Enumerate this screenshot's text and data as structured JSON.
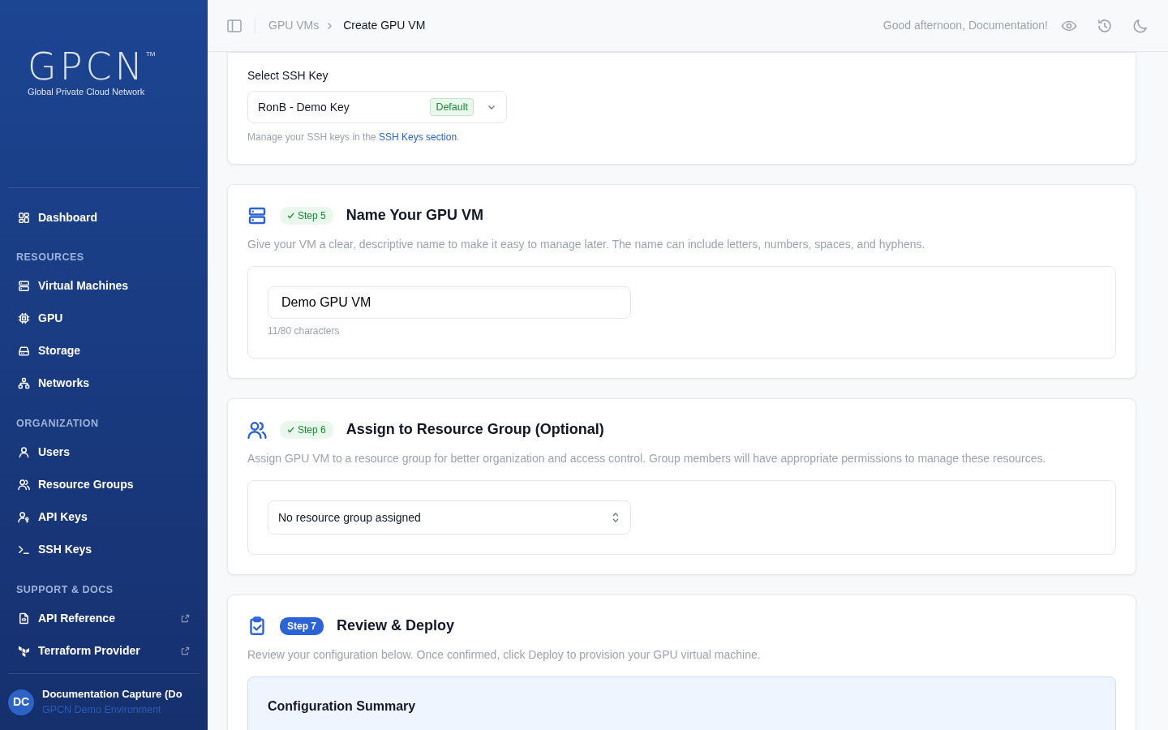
{
  "sidebar": {
    "logo": {
      "mark": "GPCN",
      "trademark": "TM",
      "tagline": "Global Private Cloud Network"
    },
    "sections": [
      {
        "items": [
          {
            "label": "Dashboard",
            "selected": false,
            "external": false
          }
        ]
      },
      {
        "heading": "RESOURCES",
        "items": [
          {
            "label": "Virtual Machines",
            "selected": false,
            "external": false
          },
          {
            "label": "GPU",
            "selected": false,
            "external": false
          },
          {
            "label": "Storage",
            "selected": false,
            "external": false
          },
          {
            "label": "Networks",
            "selected": false,
            "external": false
          }
        ]
      },
      {
        "heading": "ORGANIZATION",
        "items": [
          {
            "label": "Users",
            "selected": false,
            "external": false
          },
          {
            "label": "Resource Groups",
            "selected": false,
            "external": false
          },
          {
            "label": "API Keys",
            "selected": false,
            "external": false
          },
          {
            "label": "SSH Keys",
            "selected": false,
            "external": false
          }
        ]
      },
      {
        "heading": "SUPPORT & DOCS",
        "items": [
          {
            "label": "API Reference",
            "selected": false,
            "external": true
          },
          {
            "label": "Terraform Provider",
            "selected": false,
            "external": true
          }
        ]
      }
    ],
    "user": {
      "initials": "DC",
      "name": "Documentation Capture (Do",
      "org": "GPCN Demo Environment"
    }
  },
  "header": {
    "breadcrumbs": [
      "GPU VMs",
      "Create GPU VM"
    ],
    "greeting": "Good afternoon, Documentation!"
  },
  "ssh_card": {
    "label": "Select SSH Key",
    "value": "RonB - Demo Key",
    "badge": "Default",
    "help": "Manage your SSH keys in the ",
    "help_link": "SSH Keys section",
    "help_end": "."
  },
  "steps": [
    {
      "step": "Step 5",
      "completed": true,
      "title": "Name Your GPU VM",
      "description": "Give your VM a clear, descriptive name to make it easy to manage later. The name can include letters, numbers, spaces, and hyphens.",
      "kind": "text",
      "value": "Demo GPU VM",
      "hint": "11/80 characters"
    },
    {
      "step": "Step 6",
      "completed": true,
      "title": "Assign to Resource Group (Optional)",
      "description": "Assign GPU VM to a resource group for better organization and access control. Group members will have appropriate permissions to manage these resources.",
      "kind": "select",
      "value": "No resource group assigned"
    },
    {
      "step": "Step 7",
      "completed": false,
      "title": "Review & Deploy",
      "description": "Review your configuration below. Once confirmed, click Deploy to provision your GPU virtual machine.",
      "kind": "summary",
      "value": "Configuration Summary"
    }
  ]
}
